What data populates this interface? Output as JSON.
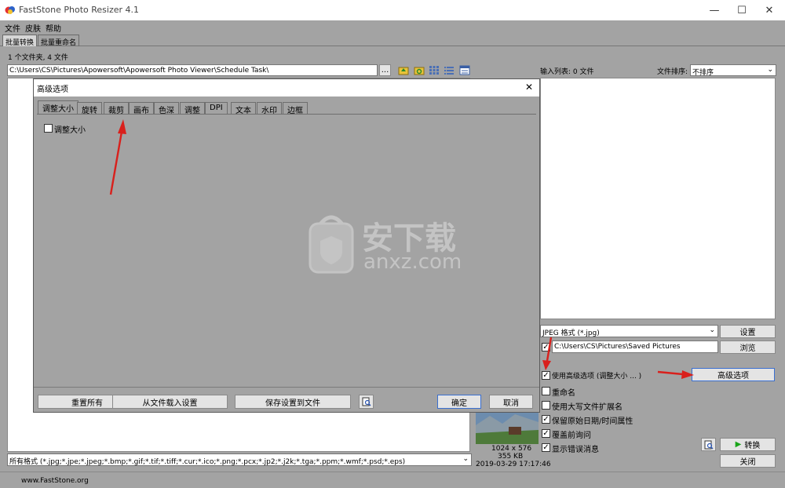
{
  "window": {
    "title": "FastStone Photo Resizer 4.1",
    "minimize": "—",
    "maximize": "☐",
    "close": "✕"
  },
  "menu": [
    "文件",
    "皮肤",
    "帮助"
  ],
  "main_tabs": [
    "批量转换",
    "批量重命名"
  ],
  "status": {
    "folder_count": "1 个文件夹, 4 文件"
  },
  "path": {
    "value": "C:\\Users\\CS\\Pictures\\Apowersoft\\Apowersoft Photo Viewer\\Schedule Task\\",
    "browse": "..."
  },
  "input_list": {
    "label": "输入列表: 0 文件",
    "sort_label": "文件排序:",
    "sort_value": "不排序"
  },
  "file_filter": "所有格式 (*.jpg;*.jpe;*.jpeg;*.bmp;*.gif;*.tif;*.tiff;*.cur;*.ico;*.png;*.pcx;*.jp2;*.j2k;*.tga;*.ppm;*.wmf;*.psd;*.eps)",
  "footer": {
    "website": "www.FastStone.org"
  },
  "preview": {
    "dimensions": "1024 x 576",
    "size": "355 KB",
    "date": "2019-03-29 17:17:46"
  },
  "output": {
    "format": "JPEG 格式 (*.jpg)",
    "settings_button": "设置",
    "folder": "C:\\Users\\CS\\Pictures\\Saved Pictures",
    "browse_button": "浏览",
    "advanced_button": "高级选项",
    "convert_button": "转换",
    "close_button": "关闭"
  },
  "options": [
    {
      "label": "使用高级选项 (调整大小 ... )",
      "checked": true
    },
    {
      "label": "重命名",
      "checked": false
    },
    {
      "label": "使用大写文件扩展名",
      "checked": false
    },
    {
      "label": "保留原始日期/时间属性",
      "checked": true
    },
    {
      "label": "覆盖前询问",
      "checked": true
    },
    {
      "label": "显示错误消息",
      "checked": true
    }
  ],
  "dialog": {
    "title": "高级选项",
    "close": "✕",
    "tabs": [
      "调整大小",
      "旋转",
      "裁剪",
      "画布",
      "色深",
      "调整",
      "DPI",
      "文本",
      "水印",
      "边框"
    ],
    "resize_checkbox": {
      "label": "调整大小",
      "checked": false
    },
    "buttons": {
      "reset_all": "重置所有",
      "load_from_file": "从文件载入设置",
      "save_to_file": "保存设置到文件",
      "ok": "确定",
      "cancel": "取消"
    }
  },
  "watermark": {
    "brand": "安下载",
    "url": "anxz.com"
  },
  "colors": {
    "accent_red": "#d9201c",
    "dialog_bg": "#a3a3a3",
    "convert_green": "#1aa51a"
  }
}
